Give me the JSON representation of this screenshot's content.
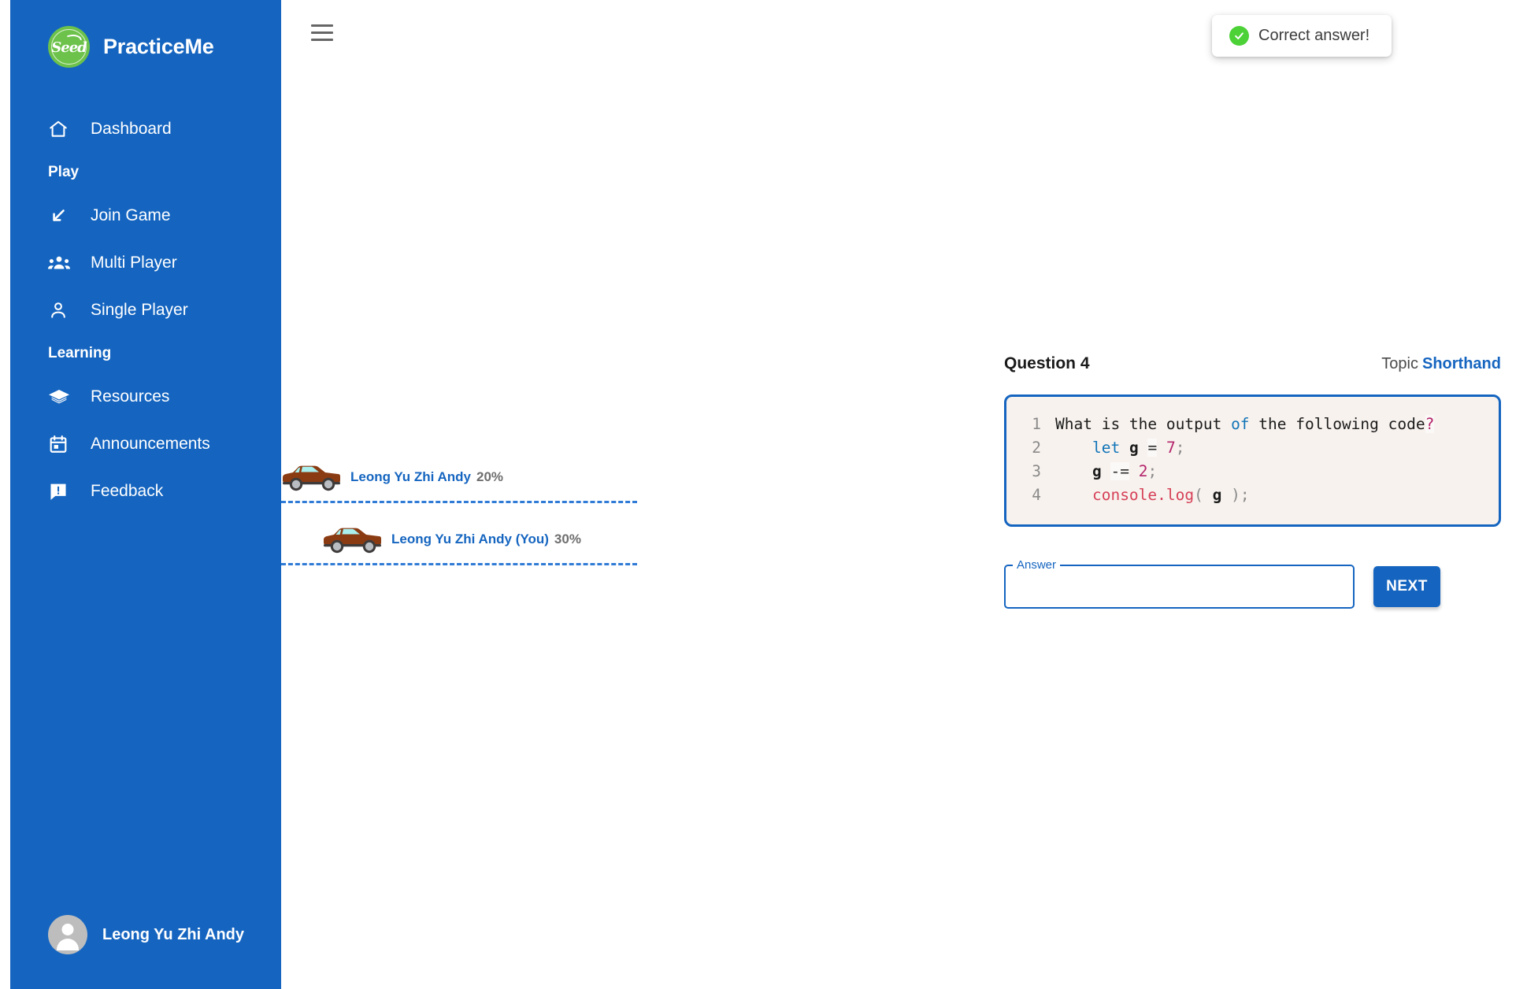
{
  "brand": {
    "title": "PracticeMe",
    "logo_text": "Seed",
    "logo_color": "#6CC24A"
  },
  "theme": {
    "sidebar_bg": "#1565C0",
    "accent": "#1565C0",
    "success": "#4CD137",
    "track_dash": "#2F7BD6"
  },
  "sidebar": {
    "items": [
      {
        "label": "Dashboard",
        "icon": "home-icon",
        "type": "item"
      },
      {
        "label": "Play",
        "type": "section"
      },
      {
        "label": "Join Game",
        "icon": "arrow-down-left-icon",
        "type": "item"
      },
      {
        "label": "Multi Player",
        "icon": "people-group-icon",
        "type": "item"
      },
      {
        "label": "Single Player",
        "icon": "person-icon",
        "type": "item"
      },
      {
        "label": "Learning",
        "type": "section"
      },
      {
        "label": "Resources",
        "icon": "graduation-cap-icon",
        "type": "item"
      },
      {
        "label": "Announcements",
        "icon": "calendar-icon",
        "type": "item"
      },
      {
        "label": "Feedback",
        "icon": "feedback-chat-icon",
        "type": "item"
      }
    ],
    "profile": {
      "name": "Leong Yu Zhi Andy",
      "avatar_icon": "account-circle-icon"
    }
  },
  "topbar": {
    "menu_icon": "hamburger-menu-icon"
  },
  "toast": {
    "message": "Correct answer!",
    "icon": "check-circle-icon"
  },
  "race": {
    "racers": [
      {
        "name": "Leong Yu Zhi Andy",
        "progress": "20%",
        "progress_value": 20,
        "car_icon": "car-icon",
        "is_you": false
      },
      {
        "name": "Leong Yu Zhi Andy (You)",
        "progress": "30%",
        "progress_value": 30,
        "car_icon": "car-icon",
        "is_you": true
      }
    ]
  },
  "question": {
    "number_label": "Question 4",
    "topic_label": "Topic",
    "topic_value": "Shorthand",
    "code_lines": [
      {
        "number": "1",
        "tokens": [
          {
            "text": "What is the output ",
            "kind": "plain"
          },
          {
            "text": "of",
            "kind": "kw"
          },
          {
            "text": " the following code",
            "kind": "plain"
          },
          {
            "text": "?",
            "kind": "q"
          }
        ]
      },
      {
        "number": "2",
        "tokens": [
          {
            "text": "    ",
            "kind": "plain"
          },
          {
            "text": "let",
            "kind": "kw"
          },
          {
            "text": " ",
            "kind": "plain"
          },
          {
            "text": "g",
            "kind": "var"
          },
          {
            "text": " ",
            "kind": "plain"
          },
          {
            "text": "=",
            "kind": "op"
          },
          {
            "text": " ",
            "kind": "plain"
          },
          {
            "text": "7",
            "kind": "num"
          },
          {
            "text": ";",
            "kind": "punc"
          }
        ]
      },
      {
        "number": "3",
        "tokens": [
          {
            "text": "    ",
            "kind": "plain"
          },
          {
            "text": "g",
            "kind": "var"
          },
          {
            "text": " ",
            "kind": "plain"
          },
          {
            "text": "-=",
            "kind": "op"
          },
          {
            "text": " ",
            "kind": "plain"
          },
          {
            "text": "2",
            "kind": "num"
          },
          {
            "text": ";",
            "kind": "punc"
          }
        ]
      },
      {
        "number": "4",
        "tokens": [
          {
            "text": "    ",
            "kind": "plain"
          },
          {
            "text": "console.log",
            "kind": "fn"
          },
          {
            "text": "( ",
            "kind": "punc"
          },
          {
            "text": "g",
            "kind": "var"
          },
          {
            "text": " )",
            "kind": "punc"
          },
          {
            "text": ";",
            "kind": "punc"
          }
        ]
      }
    ],
    "answer": {
      "legend": "Answer",
      "value": "",
      "placeholder": ""
    },
    "next_label": "NEXT"
  }
}
